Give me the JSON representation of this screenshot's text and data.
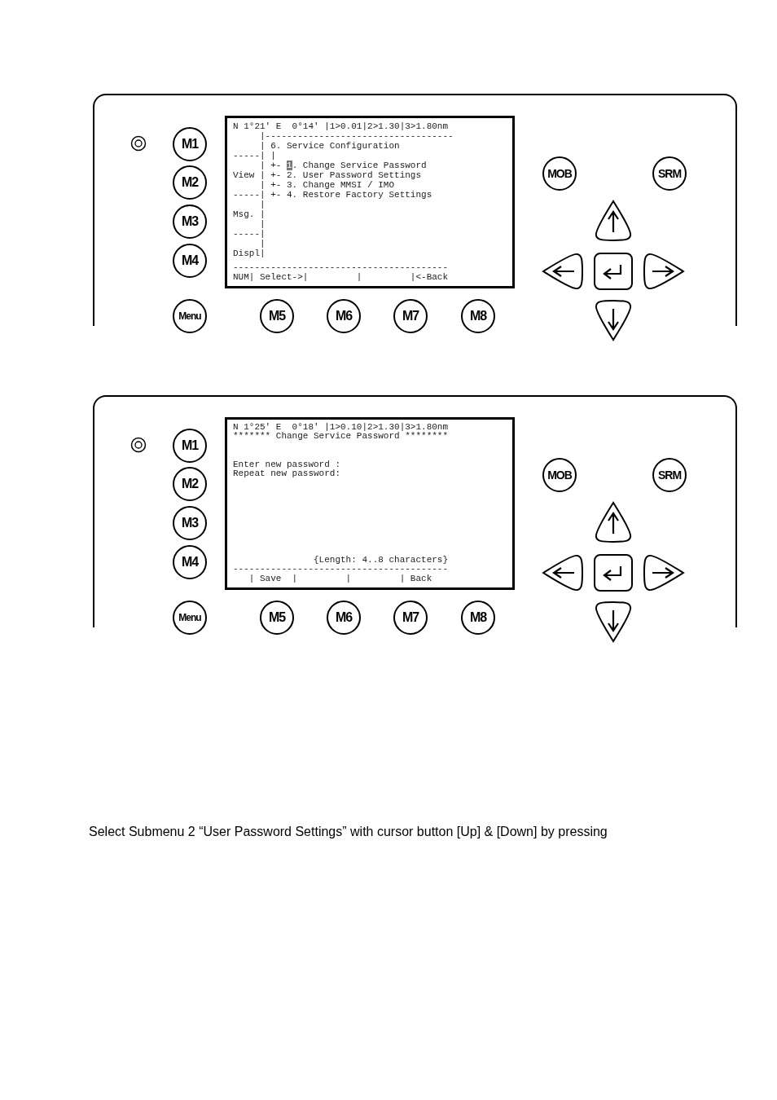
{
  "devices": [
    {
      "side_keys": [
        "M1",
        "M2",
        "M3",
        "M4"
      ],
      "bottom_keys": [
        "Menu",
        "M5",
        "M6",
        "M7",
        "M8"
      ],
      "top_keys": [
        "MOB",
        "SRM"
      ],
      "screen": {
        "top": [
          {
            "kind": "line",
            "text": "N 1°21' E  0°14' |1>0.01|2>1.30|3>1.80nm"
          },
          {
            "kind": "line",
            "text": "     |-----------------------------------"
          },
          {
            "kind": "line",
            "text": "     | 6. Service Configuration"
          },
          {
            "kind": "line",
            "text": "-----| |"
          },
          {
            "kind": "cursor",
            "before": "     | +- ",
            "cursor": "1",
            "after": ". Change Service Password"
          },
          {
            "kind": "line",
            "text": "View | +- 2. User Password Settings"
          },
          {
            "kind": "line",
            "text": "     | +- 3. Change MMSI / IMO"
          },
          {
            "kind": "line",
            "text": "-----| +- 4. Restore Factory Settings"
          },
          {
            "kind": "line",
            "text": "     |"
          },
          {
            "kind": "line",
            "text": "Msg. |"
          },
          {
            "kind": "line",
            "text": "     |"
          },
          {
            "kind": "line",
            "text": "-----|"
          },
          {
            "kind": "line",
            "text": "     |"
          },
          {
            "kind": "line",
            "text": "Displ|"
          }
        ],
        "bottom": [
          {
            "kind": "line",
            "text": "----------------------------------------"
          },
          {
            "kind": "line",
            "text": "NUM| Select->|         |         |<-Back"
          }
        ]
      }
    },
    {
      "side_keys": [
        "M1",
        "M2",
        "M3",
        "M4"
      ],
      "bottom_keys": [
        "Menu",
        "M5",
        "M6",
        "M7",
        "M8"
      ],
      "top_keys": [
        "MOB",
        "SRM"
      ],
      "screen": {
        "top": [
          {
            "kind": "line",
            "text": "N 1°25' E  0°18' |1>0.10|2>1.30|3>1.80nm"
          },
          {
            "kind": "line",
            "text": "******* Change Service Password ********"
          }
        ],
        "fields": [
          {
            "kind": "line",
            "text": "Enter new password :"
          },
          {
            "kind": "line",
            "text": "Repeat new password:"
          }
        ],
        "bottom": [
          {
            "kind": "line",
            "text": "               {Length: 4..8 characters}"
          },
          {
            "kind": "line",
            "text": "----------------------------------------"
          },
          {
            "kind": "line",
            "text": "   | Save  |         |         | Back"
          }
        ]
      }
    }
  ],
  "caption": "Select Submenu 2 “User Password Settings” with cursor button [Up] & [Down] by pressing"
}
